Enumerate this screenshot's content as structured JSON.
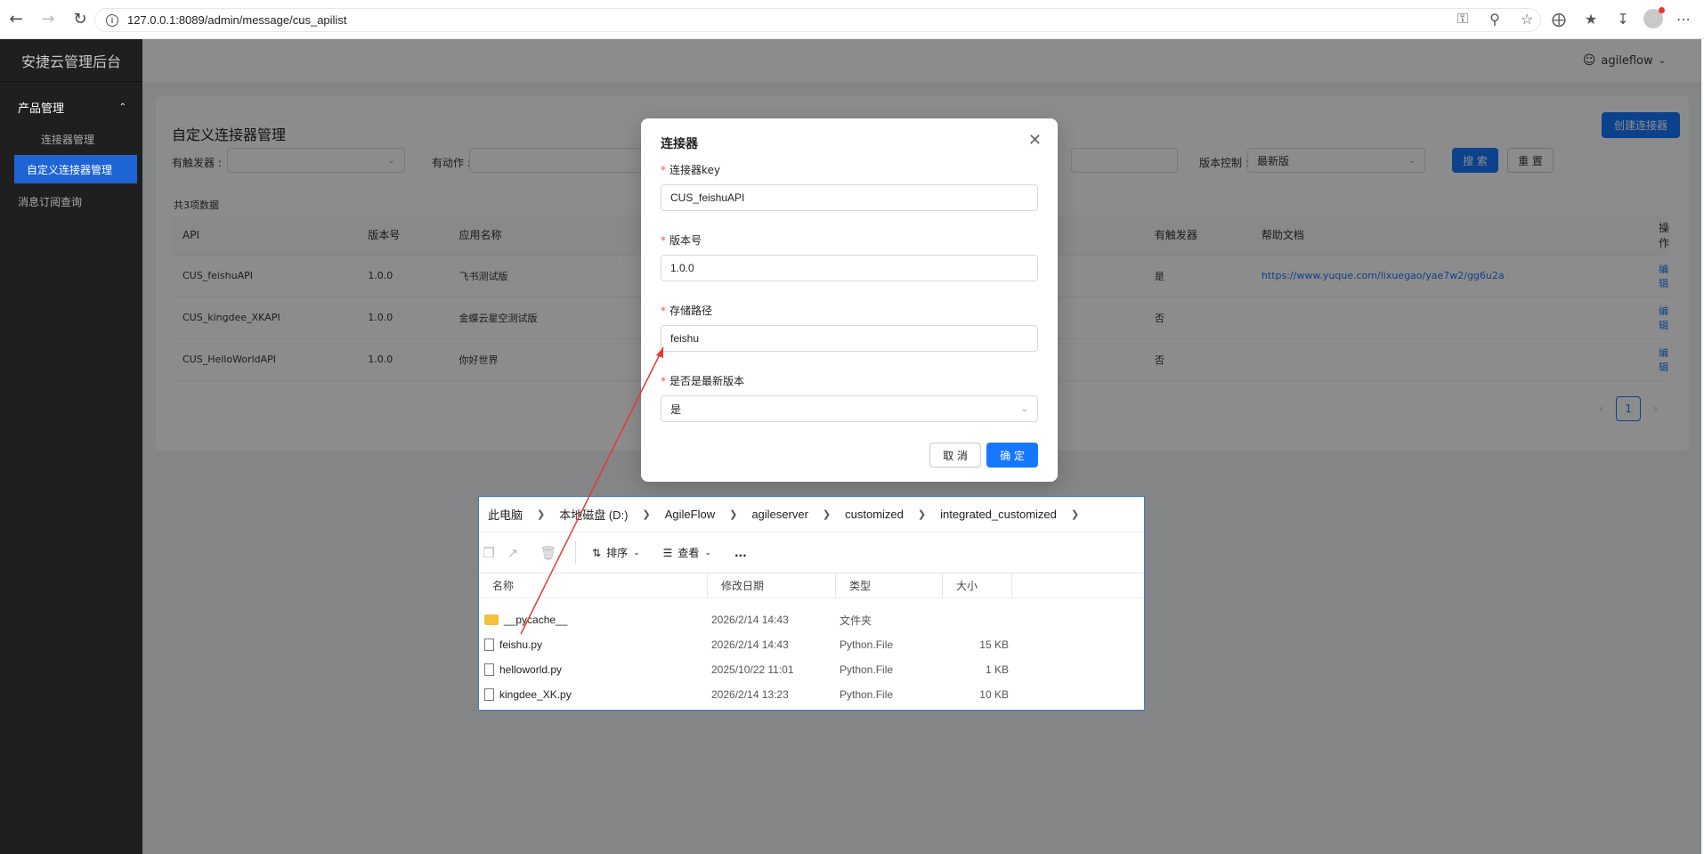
{
  "browser": {
    "url": "127.0.0.1:8089/admin/message/cus_apilist"
  },
  "sidebar": {
    "brand": "安捷云管理后台",
    "group": "产品管理",
    "items": [
      {
        "label": "连接器管理"
      },
      {
        "label": "自定义连接器管理"
      }
    ],
    "bottom_item": "消息订阅查询"
  },
  "header": {
    "user": "agileflow"
  },
  "page": {
    "title": "自定义连接器管理",
    "create_button": "创建连接器",
    "filters": {
      "trigger_label": "有触发器 :",
      "action_label": "有动作 :",
      "version_label": "版本控制 :",
      "version_value": "最新版",
      "search_button": "搜 索",
      "reset_button": "重 置"
    },
    "count_text": "共3项数据",
    "table": {
      "headers": [
        "API",
        "版本号",
        "应用名称",
        "有触发器",
        "帮助文档",
        "操作"
      ],
      "rows": [
        {
          "api": "CUS_feishuAPI",
          "version": "1.0.0",
          "app": "飞书测试版",
          "trigger": "是",
          "doc": "https://www.yuque.com/lixuegao/yae7w2/gg6u2a",
          "action": "编辑"
        },
        {
          "api": "CUS_kingdee_XKAPI",
          "version": "1.0.0",
          "app": "金蝶云星空测试版",
          "trigger": "否",
          "doc": "",
          "action": "编辑"
        },
        {
          "api": "CUS_HelloWorldAPI",
          "version": "1.0.0",
          "app": "你好世界",
          "trigger": "否",
          "doc": "",
          "action": "编辑"
        }
      ]
    },
    "pager": {
      "current": "1"
    }
  },
  "modal": {
    "title": "连接器",
    "fields": [
      {
        "label": "连接器key",
        "value": "CUS_feishuAPI"
      },
      {
        "label": "版本号",
        "value": "1.0.0"
      },
      {
        "label": "存储路径",
        "value": "feishu"
      },
      {
        "label": "是否是最新版本",
        "value": "是"
      }
    ],
    "required_mark": "*",
    "cancel": "取 消",
    "ok": "确 定"
  },
  "explorer": {
    "breadcrumb": [
      "此电脑",
      "本地磁盘 (D:)",
      "AgileFlow",
      "agileserver",
      "customized",
      "integrated_customized"
    ],
    "toolbar": {
      "sort": "排序",
      "view": "查看",
      "more": "..."
    },
    "columns": [
      "名称",
      "修改日期",
      "类型",
      "大小"
    ],
    "files": [
      {
        "name": "__pycache__",
        "date": "2026/2/14 14:43",
        "type": "文件夹",
        "size": "",
        "kind": "folder"
      },
      {
        "name": "feishu.py",
        "date": "2026/2/14 14:43",
        "type": "Python.File",
        "size": "15 KB",
        "kind": "file"
      },
      {
        "name": "helloworld.py",
        "date": "2025/10/22 11:01",
        "type": "Python.File",
        "size": "1 KB",
        "kind": "file"
      },
      {
        "name": "kingdee_XK.py",
        "date": "2026/2/14 13:23",
        "type": "Python.File",
        "size": "10 KB",
        "kind": "file"
      }
    ]
  },
  "colors": {
    "primary": "#1677ff",
    "sidebar": "#1f1f1f",
    "annotation_arrow": "#e53935"
  }
}
